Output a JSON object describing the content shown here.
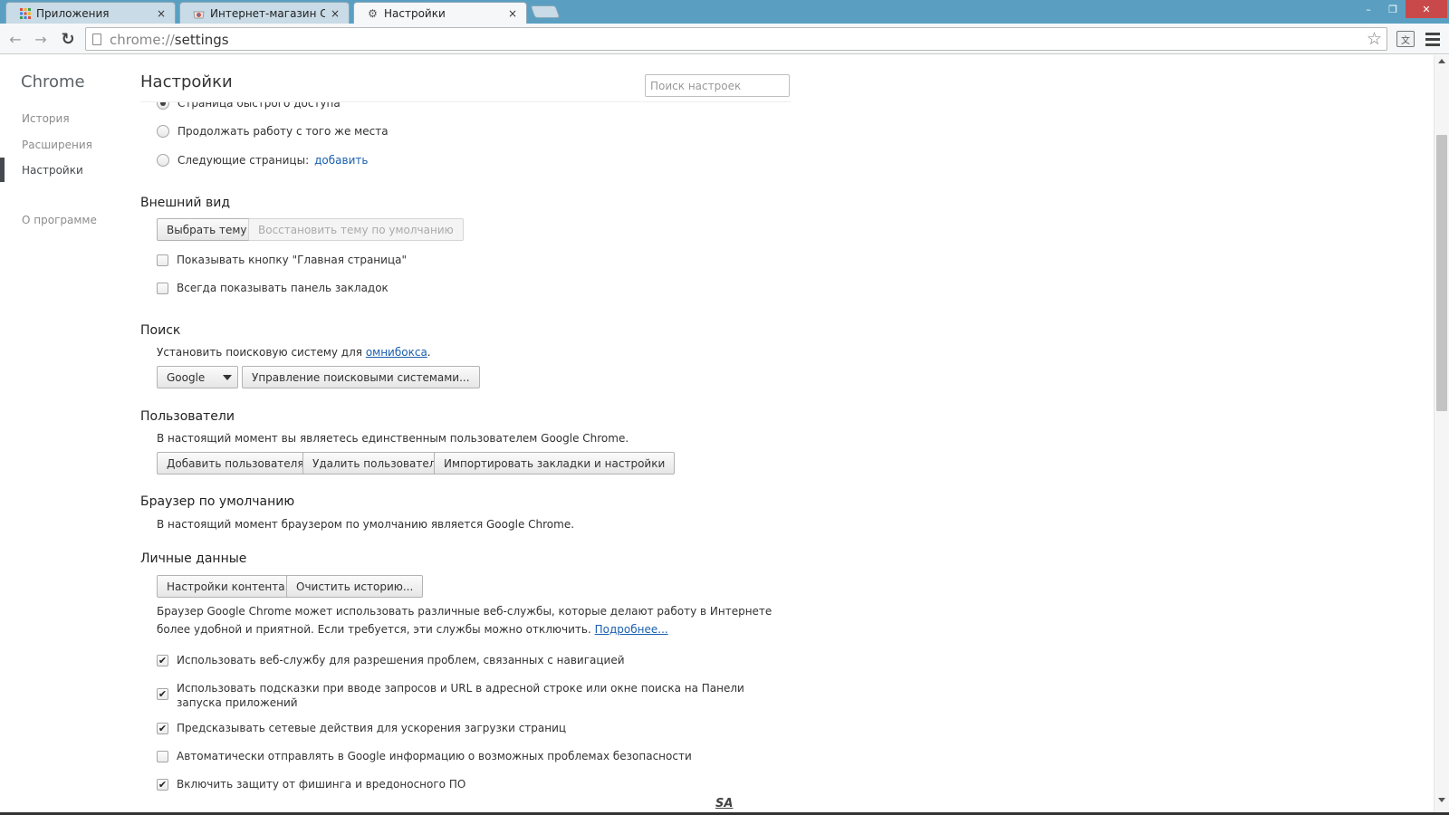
{
  "window": {
    "tabs": [
      {
        "title": "Приложения",
        "icon": "apps-grid-icon"
      },
      {
        "title": "Интернет-магазин Chrome",
        "icon": "web-store-icon"
      },
      {
        "title": "Настройки",
        "icon": "gear-icon"
      }
    ],
    "close_glyph": "×",
    "controls": {
      "minimize": "–",
      "maximize": "❐",
      "close": "✕"
    }
  },
  "toolbar": {
    "back_glyph": "←",
    "forward_glyph": "→",
    "reload_glyph": "↻",
    "url_scheme": "chrome://",
    "url_path": "settings",
    "star_glyph": "☆",
    "extension_glyph": "文"
  },
  "sidebar": {
    "brand": "Chrome",
    "items": [
      {
        "label": "История"
      },
      {
        "label": "Расширения"
      },
      {
        "label": "Настройки"
      },
      {
        "label": "О программе"
      }
    ],
    "selected": "Настройки"
  },
  "header": {
    "title": "Настройки",
    "search_placeholder": "Поиск настроек"
  },
  "startup": {
    "options": [
      {
        "label": "Страница быстрого доступа",
        "checked": true
      },
      {
        "label": "Продолжать работу с того же места",
        "checked": false
      },
      {
        "label": "Следующие страницы:",
        "checked": false,
        "link": "добавить"
      }
    ]
  },
  "appearance": {
    "title": "Внешний вид",
    "choose_theme": "Выбрать тему",
    "reset_theme": "Восстановить тему по умолчанию",
    "checkboxes": [
      {
        "label": "Показывать кнопку \"Главная страница\"",
        "checked": false
      },
      {
        "label": "Всегда показывать панель закладок",
        "checked": false
      }
    ]
  },
  "search": {
    "title": "Поиск",
    "description": "Установить поисковую систему для",
    "description_link": "омнибокса",
    "description_end": ".",
    "engine": "Google",
    "manage": "Управление поисковыми системами..."
  },
  "users": {
    "title": "Пользователи",
    "description": "В настоящий момент вы являетесь единственным пользователем Google Chrome.",
    "add": "Добавить пользователя...",
    "remove": "Удалить пользователя",
    "import": "Импортировать закладки и настройки"
  },
  "default_browser": {
    "title": "Браузер по умолчанию",
    "description": "В настоящий момент браузером по умолчанию является Google Chrome."
  },
  "privacy": {
    "title": "Личные данные",
    "content_settings": "Настройки контента...",
    "clear_history": "Очистить историю...",
    "description_line1": "Браузер Google Chrome может использовать различные веб-службы, которые делают работу в Интернете",
    "description_line2": "более удобной и приятной. Если требуется, эти службы можно отключить.",
    "learn_more": "Подробнее...",
    "checkboxes": [
      {
        "label": "Использовать веб-службу для разрешения проблем, связанных с навигацией",
        "checked": true
      },
      {
        "label_line1": "Использовать подсказки при вводе запросов и URL в адресной строке или окне поиска на Панели",
        "label_line2": "запуска приложений",
        "checked": true
      },
      {
        "label": "Предсказывать сетевые действия для ускорения загрузки страниц",
        "checked": true
      },
      {
        "label": "Автоматически отправлять в Google информацию о возможных проблемах безопасности",
        "checked": false
      },
      {
        "label": "Включить защиту от фишинга и вредоносного ПО",
        "checked": true
      }
    ],
    "check_glyph": "✔"
  },
  "watermark": "SA",
  "colors": {
    "tabstrip": "#5a9fc2",
    "link": "#1a5faf",
    "close_button": "#c9494a"
  }
}
